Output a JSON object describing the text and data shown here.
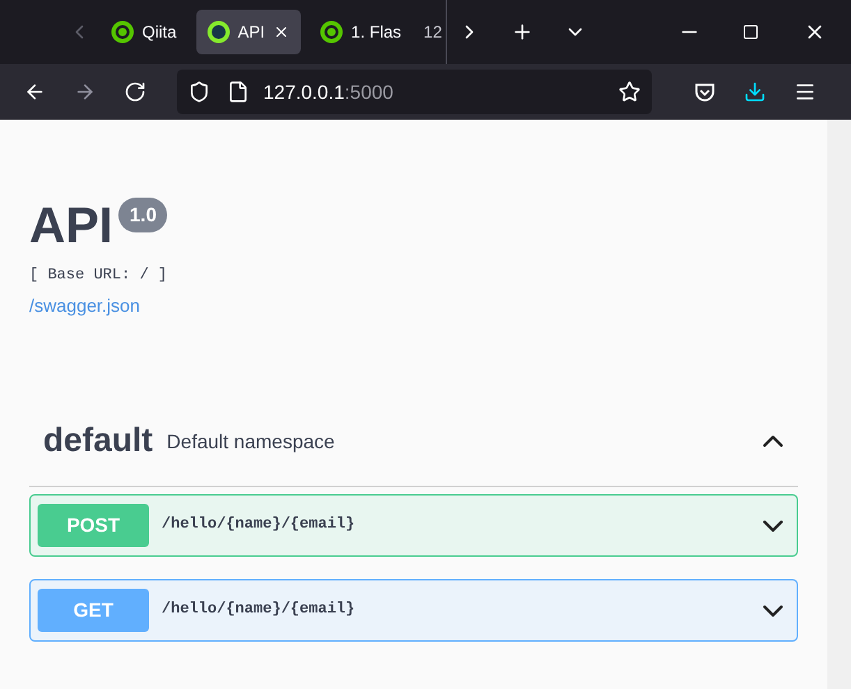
{
  "tabs": [
    {
      "label": "Qiita",
      "selected": false,
      "kind": "qiita"
    },
    {
      "label": "API",
      "selected": true,
      "kind": "swagger"
    },
    {
      "label": "1. Flas",
      "selected": false,
      "kind": "qiita"
    },
    {
      "label": "12",
      "selected": false,
      "kind": "plain"
    }
  ],
  "address": {
    "host": "127.0.0.1",
    "port": ":5000"
  },
  "page": {
    "title": "API",
    "version": "1.0",
    "base_url": "[ Base URL: / ]",
    "spec_link": "/swagger.json"
  },
  "section": {
    "name": "default",
    "description": "Default namespace",
    "expanded": true
  },
  "operations": [
    {
      "method": "POST",
      "kind": "post",
      "path": "/hello/{name}/{email}"
    },
    {
      "method": "GET",
      "kind": "get",
      "path": "/hello/{name}/{email}"
    }
  ]
}
